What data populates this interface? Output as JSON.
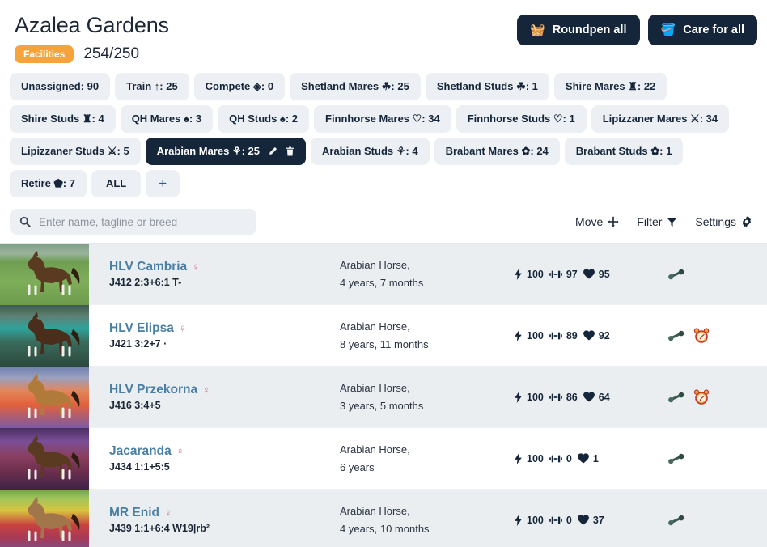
{
  "header": {
    "title": "Azalea Gardens",
    "badge_label": "Facilities",
    "badge_color": "#f7a33c",
    "counter": "254/250",
    "actions": [
      {
        "label": "Roundpen all",
        "icon": "roundpen-icon",
        "glyph": "🧺"
      },
      {
        "label": "Care for all",
        "icon": "care-icon",
        "glyph": "🪣"
      }
    ]
  },
  "tabs": [
    {
      "icon": "",
      "label": "Unassigned: 90",
      "active": false
    },
    {
      "icon": "↑",
      "label": "Train ↑: 25",
      "active": false
    },
    {
      "icon": "◈",
      "label": "Compete ◈: 0",
      "active": false
    },
    {
      "icon": "☘",
      "label": "Shetland Mares ☘: 25",
      "active": false
    },
    {
      "icon": "☘",
      "label": "Shetland Studs ☘: 1",
      "active": false
    },
    {
      "icon": "♜",
      "label": "Shire Mares ♜: 22",
      "active": false
    },
    {
      "icon": "♜",
      "label": "Shire Studs ♜: 4",
      "active": false
    },
    {
      "icon": "♠",
      "label": "QH Mares ♠: 3",
      "active": false
    },
    {
      "icon": "♠",
      "label": "QH Studs ♠: 2",
      "active": false
    },
    {
      "icon": "♡",
      "label": "Finnhorse Mares ♡: 34",
      "active": false
    },
    {
      "icon": "♡",
      "label": "Finnhorse Studs ♡: 1",
      "active": false
    },
    {
      "icon": "⚔",
      "label": "Lipizzaner Mares ⚔: 34",
      "active": false
    },
    {
      "icon": "⚔",
      "label": "Lipizzaner Studs ⚔: 5",
      "active": false
    },
    {
      "icon": "⚘",
      "label": "Arabian Mares ⚘: 25",
      "active": true,
      "edit": "✎",
      "delete": "🗑"
    },
    {
      "icon": "⚘",
      "label": "Arabian Studs ⚘: 4",
      "active": false
    },
    {
      "icon": "✿",
      "label": "Brabant Mares ✿: 24",
      "active": false
    },
    {
      "icon": "✿",
      "label": "Brabant Studs ✿: 1",
      "active": false
    },
    {
      "icon": "⬟",
      "label": "Retire ⬟: 7",
      "active": false
    },
    {
      "icon": "",
      "label": "ALL",
      "active": false
    }
  ],
  "tab_add_label": "+",
  "toolbar": {
    "search_placeholder": "Enter name, tagline or breed",
    "search_value": "",
    "move_label": "Move",
    "move_glyph": "✣",
    "filter_label": "Filter",
    "filter_glyph": "▼",
    "settings_label": "Settings",
    "settings_glyph": "⚙"
  },
  "horses": [
    {
      "name": "HLV Cambria",
      "sex": "♀",
      "code": "J412 2:3+6:1 T-",
      "breed": "Arabian Horse,",
      "age": "4 years, 7 months",
      "energy": "100",
      "training": "97",
      "health": "95",
      "actions": [
        "roundpen"
      ],
      "scene": "meadow"
    },
    {
      "name": "HLV Elipsa",
      "sex": "♀",
      "code": "J421 3:2+7 ·",
      "breed": "Arabian Horse,",
      "age": "8 years, 11 months",
      "energy": "100",
      "training": "89",
      "health": "92",
      "actions": [
        "roundpen",
        "clock"
      ],
      "scene": "waterfall"
    },
    {
      "name": "HLV Przekorna",
      "sex": "♀",
      "code": "J416 3:4+5",
      "breed": "Arabian Horse,",
      "age": "3 years, 5 months",
      "energy": "100",
      "training": "86",
      "health": "64",
      "actions": [
        "roundpen",
        "clock"
      ],
      "scene": "sunset"
    },
    {
      "name": "Jacaranda",
      "sex": "♀",
      "code": "J434 1:1+5:5",
      "breed": "Arabian Horse,",
      "age": "6 years",
      "energy": "100",
      "training": "0",
      "health": "1",
      "actions": [
        "roundpen"
      ],
      "scene": "purple"
    },
    {
      "name": "MR Enid",
      "sex": "♀",
      "code": "J439 1:1+6:4 W19|rb²",
      "breed": "Arabian Horse,",
      "age": "4 years, 10 months",
      "energy": "100",
      "training": "0",
      "health": "37",
      "actions": [
        "roundpen"
      ],
      "scene": "tulips"
    }
  ],
  "icons": {
    "energy": "⚡",
    "training": "🏋",
    "health": "♥",
    "roundpen": "🦴",
    "clock": "⏰",
    "search": "🔍"
  }
}
